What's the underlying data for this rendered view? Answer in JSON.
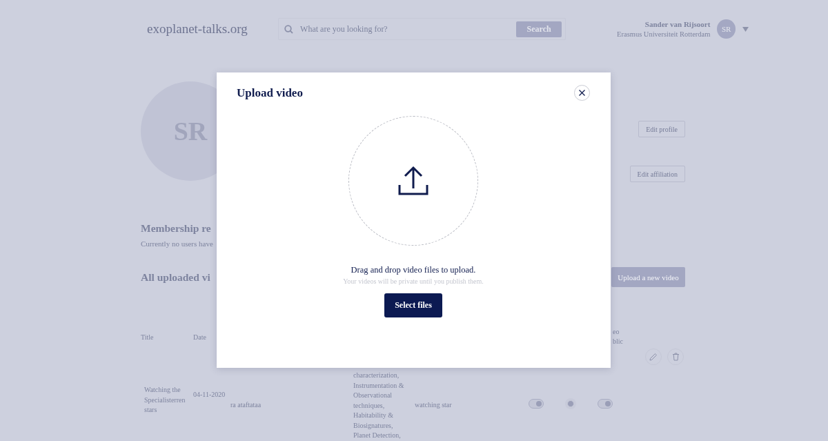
{
  "header": {
    "logo": "exoplanet-talks.org",
    "search": {
      "placeholder": "What are you looking for?",
      "button": "Search"
    },
    "user": {
      "name": "Sander van Rijsoort",
      "affiliation": "Erasmus Universiteit Rotterdam",
      "initials": "SR"
    }
  },
  "profile": {
    "initials": "SR",
    "buttons": [
      "Edit profile",
      "Edit affiliation"
    ]
  },
  "membership": {
    "heading": "Membership re",
    "text": "Currently no users have"
  },
  "videos": {
    "heading": "All uploaded vi",
    "upload_button": "Upload a new video",
    "columns": [
      "Title",
      "Date",
      "eo blic"
    ],
    "rows": [
      {
        "title": "Watching the Specialisterren stars",
        "date": "04-11-2020",
        "description": "ra ataftataa",
        "topics": "characterization, Instrumentation & Observational techniques, Habitability & Biosignatures, Planet Detection,",
        "keywords": "watching star",
        "toggle_1": {
          "on": true
        },
        "radio": {
          "selected": true
        },
        "toggle_2": {
          "on": true
        }
      }
    ]
  },
  "modal": {
    "title": "Upload video",
    "prompt": "Drag and drop video files to upload.",
    "hint": "Your videos will be private until you publish them.",
    "button": "Select files"
  }
}
